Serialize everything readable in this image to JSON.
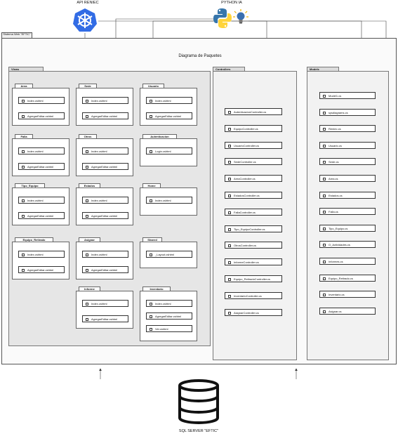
{
  "top": {
    "api_label": "API RENIEC",
    "python_label": "PYTHON IA"
  },
  "system": {
    "tab_label": "Sistema Web \"EFTIC\"",
    "diagram_title": "Diagrama de Paquetes"
  },
  "views": {
    "label": "Views",
    "packages": [
      {
        "name": "Area",
        "files": [
          "Index.cshtml",
          "AgregarEditar.cshtml"
        ]
      },
      {
        "name": "Sede",
        "files": [
          "Index.cshtml",
          "AgregarEditar.cshtml"
        ]
      },
      {
        "name": "Usuario",
        "files": [
          "Index.cshtml",
          "AgregarEditar.cshtml"
        ]
      },
      {
        "name": "Falla",
        "files": [
          "Index.cshtml",
          "AgregarEditar.cshtml"
        ]
      },
      {
        "name": "Otros",
        "files": [
          "Index.cshtml",
          "AgregarEditar.cshtml"
        ]
      },
      {
        "name": "Autenticacion",
        "files": [
          "Login.cshtml"
        ]
      },
      {
        "name": "Tipo_Equipo",
        "files": [
          "Index.cshtml",
          "AgregarEditar.cshtml"
        ]
      },
      {
        "name": "Estados",
        "files": [
          "Index.cshtml",
          "AgregarEditar.cshtml"
        ]
      },
      {
        "name": "Home",
        "files": [
          "Index.cshtml"
        ]
      },
      {
        "name": "Equipo_Retirado",
        "files": [
          "Index.cshtml",
          "AgregarEditar.cshtml"
        ]
      },
      {
        "name": "Asignar",
        "files": [
          "Index.cshtml",
          "AgregarEditar.cshtml"
        ]
      },
      {
        "name": "Shared",
        "files": [
          "_Layout.cshtml"
        ]
      },
      {
        "name": "Informe",
        "files": [
          "Index.cshtml",
          "AgregarEditar.cshtml"
        ]
      },
      {
        "name": "Inventario",
        "files": [
          "Index.cshtml",
          "AgregarEditar.cshtml",
          "Ver.cshtml"
        ]
      }
    ]
  },
  "controllers": {
    "label": "Controllers",
    "items": [
      "AutenticacionController.cs",
      "EquipoController.cs",
      "UsuarioController.cs",
      "SedeController.cs",
      "AreaController.cs",
      "EstadosController.cs",
      "FallaController.cs",
      "Tipo_EquipoController.cs",
      "OtrosController.cs",
      "InformeController.cs",
      "Equipo_RetiradoController.cs",
      "InventarioController.cs",
      "AsignarController.cs"
    ]
  },
  "models": {
    "label": "Models",
    "items": [
      "Model1.cs",
      "sysdiagrams.cs",
      "Reniec.cs",
      "Usuario.cs",
      "Sede.cs",
      "Area.cs",
      "Estados.cs",
      "Falla.cs",
      "Tipo_Equipo.cs",
      "O_Actividades.cs",
      "Informes.cs",
      "Equipo_Retirado.cs",
      "Inventario.cs",
      "Asignar.cs"
    ]
  },
  "database": {
    "label": "SQL SERVER \"EFTIC\""
  },
  "colors": {
    "api_blue": "#326ce5",
    "python_blue": "#3776ab",
    "python_yellow": "#ffd43b"
  }
}
